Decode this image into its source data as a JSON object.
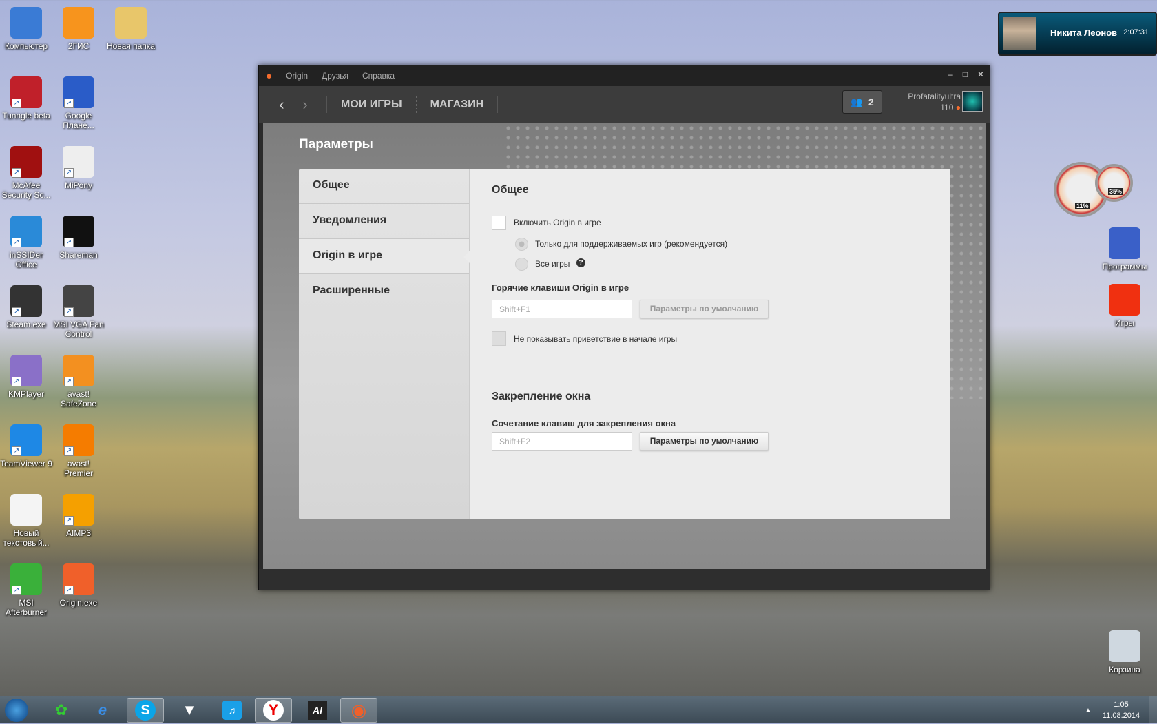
{
  "desktop": {
    "left_icons": [
      {
        "label": "Компьютер",
        "icon": "computer-icon",
        "color": "#3a7bd5"
      },
      {
        "label": "2ГИС",
        "icon": "map-pin-icon",
        "color": "#f7941d"
      },
      {
        "label": "Новая папка",
        "icon": "folder-icon",
        "color": "#e8c66a"
      },
      {
        "label": "Tunngle beta",
        "icon": "tunngle-icon",
        "color": "#c0202a"
      },
      {
        "label": "Google Плане...",
        "icon": "globe-icon",
        "color": "#2a5cc8"
      },
      {
        "label": "McAfee Security Sc...",
        "icon": "shield-icon",
        "color": "#a01010"
      },
      {
        "label": "MiPony",
        "icon": "pony-icon",
        "color": "#eeeeee"
      },
      {
        "label": "inSSIDer Office",
        "icon": "wifi-icon",
        "color": "#2a8ad8"
      },
      {
        "label": "Shareman",
        "icon": "shareman-icon",
        "color": "#111111"
      },
      {
        "label": "Steam.exe",
        "icon": "steam-icon",
        "color": "#333333"
      },
      {
        "label": "MSI VGA Fan Control",
        "icon": "fan-icon",
        "color": "#444444"
      },
      {
        "label": "KMPlayer",
        "icon": "play-icon",
        "color": "#8a70c8"
      },
      {
        "label": "avast! SafeZone",
        "icon": "globe-icon",
        "color": "#f39020"
      },
      {
        "label": "TeamViewer 9",
        "icon": "teamviewer-icon",
        "color": "#1e88e5"
      },
      {
        "label": "avast! Premier",
        "icon": "avast-icon",
        "color": "#f57c00"
      },
      {
        "label": "Новый текстовый...",
        "icon": "text-file-icon",
        "color": "#f4f4f4"
      },
      {
        "label": "AIMP3",
        "icon": "aimp-icon",
        "color": "#f5a000"
      },
      {
        "label": "MSI Afterburner",
        "icon": "afterburner-icon",
        "color": "#3ab03a"
      },
      {
        "label": "Origin.exe",
        "icon": "origin-icon",
        "color": "#f0602a"
      }
    ],
    "right_icons": [
      {
        "label": "Программы",
        "icon": "drive-icon",
        "color": "#3a60c8"
      },
      {
        "label": "Игры",
        "icon": "games-icon",
        "color": "#f03010"
      },
      {
        "label": "Корзина",
        "icon": "recycle-bin-icon",
        "color": "#cfd8e0"
      }
    ],
    "gadget": {
      "cpu": "11%",
      "ram": "35%"
    }
  },
  "notification": {
    "name": "Никита Леонов",
    "time": "2:07:31"
  },
  "window": {
    "menu": [
      "Origin",
      "Друзья",
      "Справка"
    ],
    "nav_tabs": [
      "МОИ ИГРЫ",
      "МАГАЗИН"
    ],
    "friends_count": "2",
    "username": "Profatalityultra",
    "points": "110",
    "page_title": "Параметры",
    "sidebar": [
      "Общее",
      "Уведомления",
      "Origin в игре",
      "Расширенные"
    ],
    "active_sidebar": "Origin в игре",
    "section1": {
      "title": "Общее",
      "enable_label": "Включить Origin в игре",
      "enable_checked": false,
      "radio_supported": "Только для поддерживаемых игр (рекомендуется)",
      "radio_all": "Все игры",
      "hotkeys_label": "Горячие клавиши Origin в игре",
      "hotkey_value": "Shift+F1",
      "default_button": "Параметры по умолчанию",
      "no_greeting_label": "Не показывать приветствие в начале игры",
      "no_greeting_checked": false
    },
    "section2": {
      "title": "Закрепление окна",
      "hotkeys_label": "Сочетание клавиш для закрепления окна",
      "hotkey_value": "Shift+F2",
      "default_button": "Параметры по умолчанию"
    },
    "accent": "#f56c2d"
  },
  "taskbar": {
    "items": [
      "start-icon",
      "icq-icon",
      "internet-explorer-icon",
      "skype-icon",
      "foobar-icon",
      "music-player-icon",
      "yandex-browser-icon",
      "ai-icon",
      "origin-icon"
    ],
    "time": "1:05",
    "date": "11.08.2014"
  }
}
